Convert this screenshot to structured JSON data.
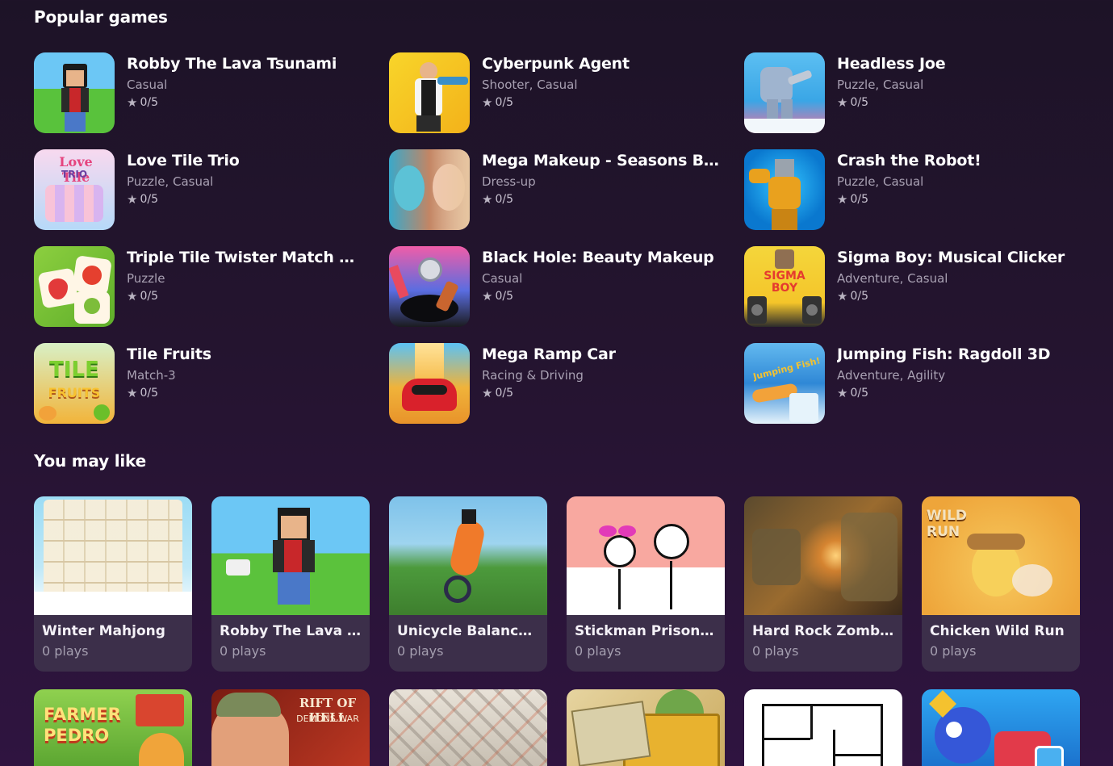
{
  "popular": {
    "title": "Popular games",
    "items": [
      {
        "title": "Robby The Lava Tsunami",
        "tags": "Casual",
        "rating": "0/5"
      },
      {
        "title": "Cyberpunk Agent",
        "tags": "Shooter, Casual",
        "rating": "0/5"
      },
      {
        "title": "Headless Joe",
        "tags": "Puzzle, Casual",
        "rating": "0/5"
      },
      {
        "title": "Love Tile Trio",
        "tags": "Puzzle, Casual",
        "rating": "0/5"
      },
      {
        "title": "Mega Makeup - Seasons Best",
        "tags": "Dress-up",
        "rating": "0/5"
      },
      {
        "title": "Crash the Robot!",
        "tags": "Puzzle, Casual",
        "rating": "0/5"
      },
      {
        "title": "Triple Tile Twister Match Ga...",
        "tags": "Puzzle",
        "rating": "0/5"
      },
      {
        "title": "Black Hole: Beauty Makeup",
        "tags": "Casual",
        "rating": "0/5"
      },
      {
        "title": "Sigma Boy: Musical Clicker",
        "tags": "Adventure, Casual",
        "rating": "0/5"
      },
      {
        "title": "Tile Fruits",
        "tags": "Match-3",
        "rating": "0/5"
      },
      {
        "title": "Mega Ramp Car",
        "tags": "Racing & Driving",
        "rating": "0/5"
      },
      {
        "title": "Jumping Fish: Ragdoll 3D",
        "tags": "Adventure, Agility",
        "rating": "0/5"
      }
    ]
  },
  "you_may_like": {
    "title": "You may like",
    "cards": [
      {
        "title": "Winter Mahjong",
        "plays": "0 plays"
      },
      {
        "title": "Robby The Lava T...",
        "plays": "0 plays"
      },
      {
        "title": "Unicycle Balance ...",
        "plays": "0 plays"
      },
      {
        "title": "Stickman Prison a...",
        "plays": "0 plays"
      },
      {
        "title": "Hard Rock Zombi...",
        "plays": "0 plays"
      },
      {
        "title": "Chicken Wild Run",
        "plays": "0 plays"
      }
    ],
    "thumb_text": {
      "chicken_logo": "WILD RUN",
      "farmer_logo": "FARMER PEDRO",
      "rift_logo": "RIFT OF HELL",
      "rift_sub": "DEMONS WAR"
    }
  },
  "thumb_text": {
    "love_logo": "Love Tile",
    "love_sub": "TRIO",
    "sigma_logo": "SIGMA BOY",
    "tile_logo": "TILE",
    "tile_sub": "FRUITS",
    "fish_logo": "Jumping Fish!"
  },
  "icons": {
    "rating": "star-icon"
  }
}
